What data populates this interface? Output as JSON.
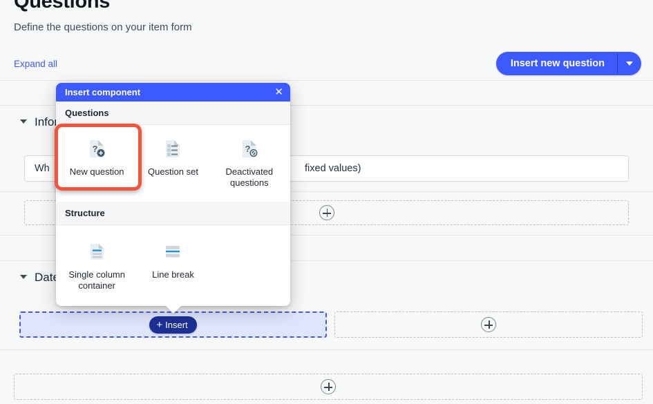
{
  "header": {
    "title": "Questions",
    "subtitle": "Define the questions on your item form",
    "expand_all": "Expand all"
  },
  "primary_button": {
    "label": "Insert new question",
    "caret_icon": "chevron-down-icon",
    "color": "#3d5afe"
  },
  "form": {
    "sections": [
      {
        "label": "Infor",
        "chevron": "chevron-down-icon"
      },
      {
        "label": "Date",
        "chevron": "chevron-down-icon"
      }
    ],
    "field": {
      "value_start": "Wh",
      "value_end": "fixed values)"
    },
    "dropzones": {
      "plus_icon": "plus-circle-icon",
      "active_label": "Insert",
      "active_plus": "+"
    }
  },
  "popup": {
    "title": "Insert component",
    "close_icon": "close-icon",
    "groups": [
      {
        "title": "Questions",
        "items": [
          {
            "label": "New question",
            "icon": "question-document-add-icon",
            "highlighted": true
          },
          {
            "label": "Question set",
            "icon": "question-list-document-icon",
            "highlighted": false
          },
          {
            "label": "Deactivated questions",
            "icon": "question-document-blocked-icon",
            "highlighted": false
          }
        ]
      },
      {
        "title": "Structure",
        "items": [
          {
            "label": "Single column container",
            "icon": "single-column-container-icon"
          },
          {
            "label": "Line break",
            "icon": "line-break-icon"
          }
        ]
      }
    ]
  },
  "annotation": {
    "color": "#f4543c",
    "target": "New question"
  }
}
